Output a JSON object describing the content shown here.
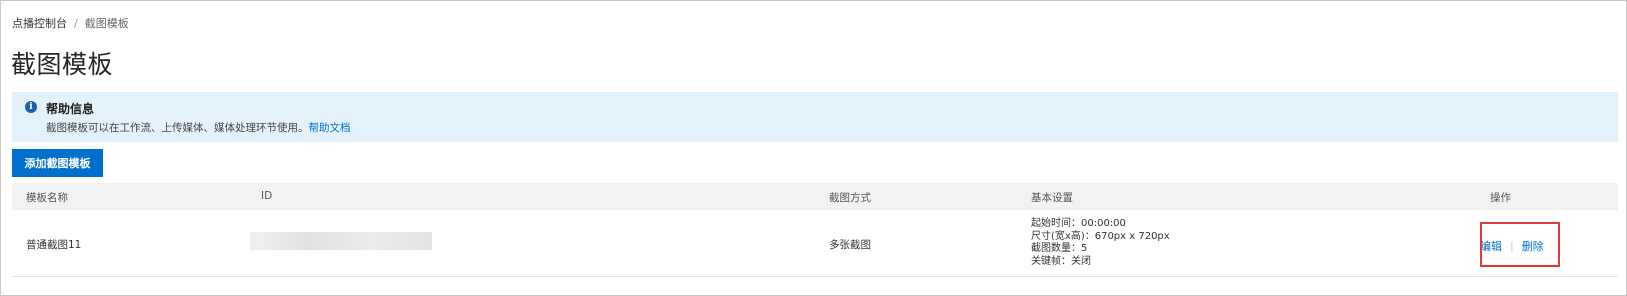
{
  "breadcrumb": {
    "root": "点播控制台",
    "separator": "/",
    "current": "截图模板"
  },
  "page_title": "截图模板",
  "help": {
    "icon": "info-icon",
    "title": "帮助信息",
    "text": "截图模板可以在工作流、上传媒体、媒体处理环节使用。",
    "link": "帮助文档"
  },
  "toolbar": {
    "add_label": "添加截图模板"
  },
  "table": {
    "columns": [
      "模板名称",
      "ID",
      "截图方式",
      "基本设置",
      "操作"
    ],
    "rows": [
      {
        "name": "普通截图11",
        "id": "",
        "mode": "多张截图",
        "settings": [
          "起始时间：00:00:00",
          "尺寸(宽x高)：670px x 720px",
          "截图数量：5",
          "关键帧：关闭"
        ],
        "actions": {
          "edit": "编辑",
          "separator": "|",
          "delete": "删除"
        }
      }
    ]
  },
  "colors": {
    "primary": "#0070cc",
    "help_bg": "#e3f1fb",
    "highlight": "#e03a3a"
  }
}
